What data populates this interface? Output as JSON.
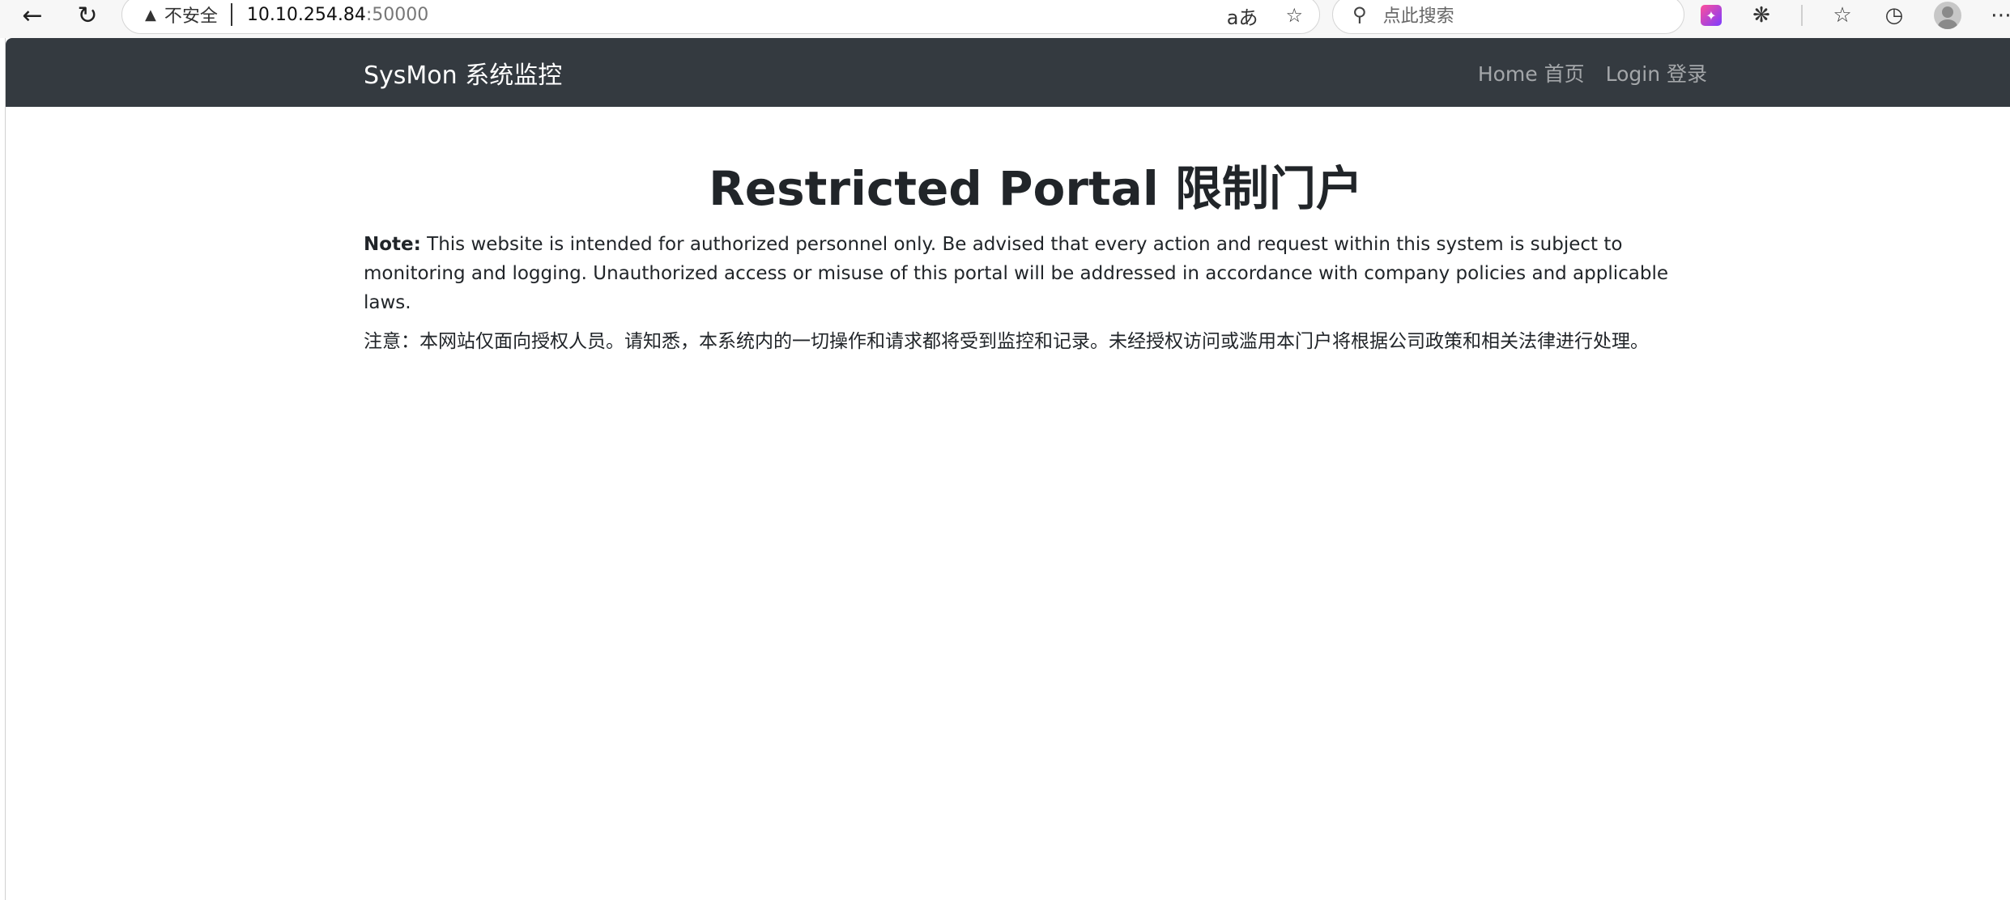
{
  "browser": {
    "security_label": "不安全",
    "url_host": "10.10.254.84",
    "url_port": ":50000",
    "translate_icon": "aあ",
    "search_placeholder": "点此搜索"
  },
  "site": {
    "brand": "SysMon  系统监控",
    "nav": {
      "home": "Home  首页",
      "login": "Login  登录"
    }
  },
  "main": {
    "title": "Restricted Portal  限制门户",
    "note_label": "Note:",
    "note_en": " This website is intended for authorized personnel only. Be advised that every action and request within this system is subject to monitoring and logging. Unauthorized access or misuse of this portal will be addressed in accordance with company policies and applicable laws.",
    "note_zh": "注意：本网站仅面向授权人员。请知悉，本系统内的一切操作和请求都将受到监控和记录。未经授权访问或滥用本门户将根据公司政策和相关法律进行处理。"
  },
  "colors": {
    "navbar_bg": "#343a40",
    "nav_link": "rgba(255,255,255,0.55)",
    "text": "#212529"
  }
}
